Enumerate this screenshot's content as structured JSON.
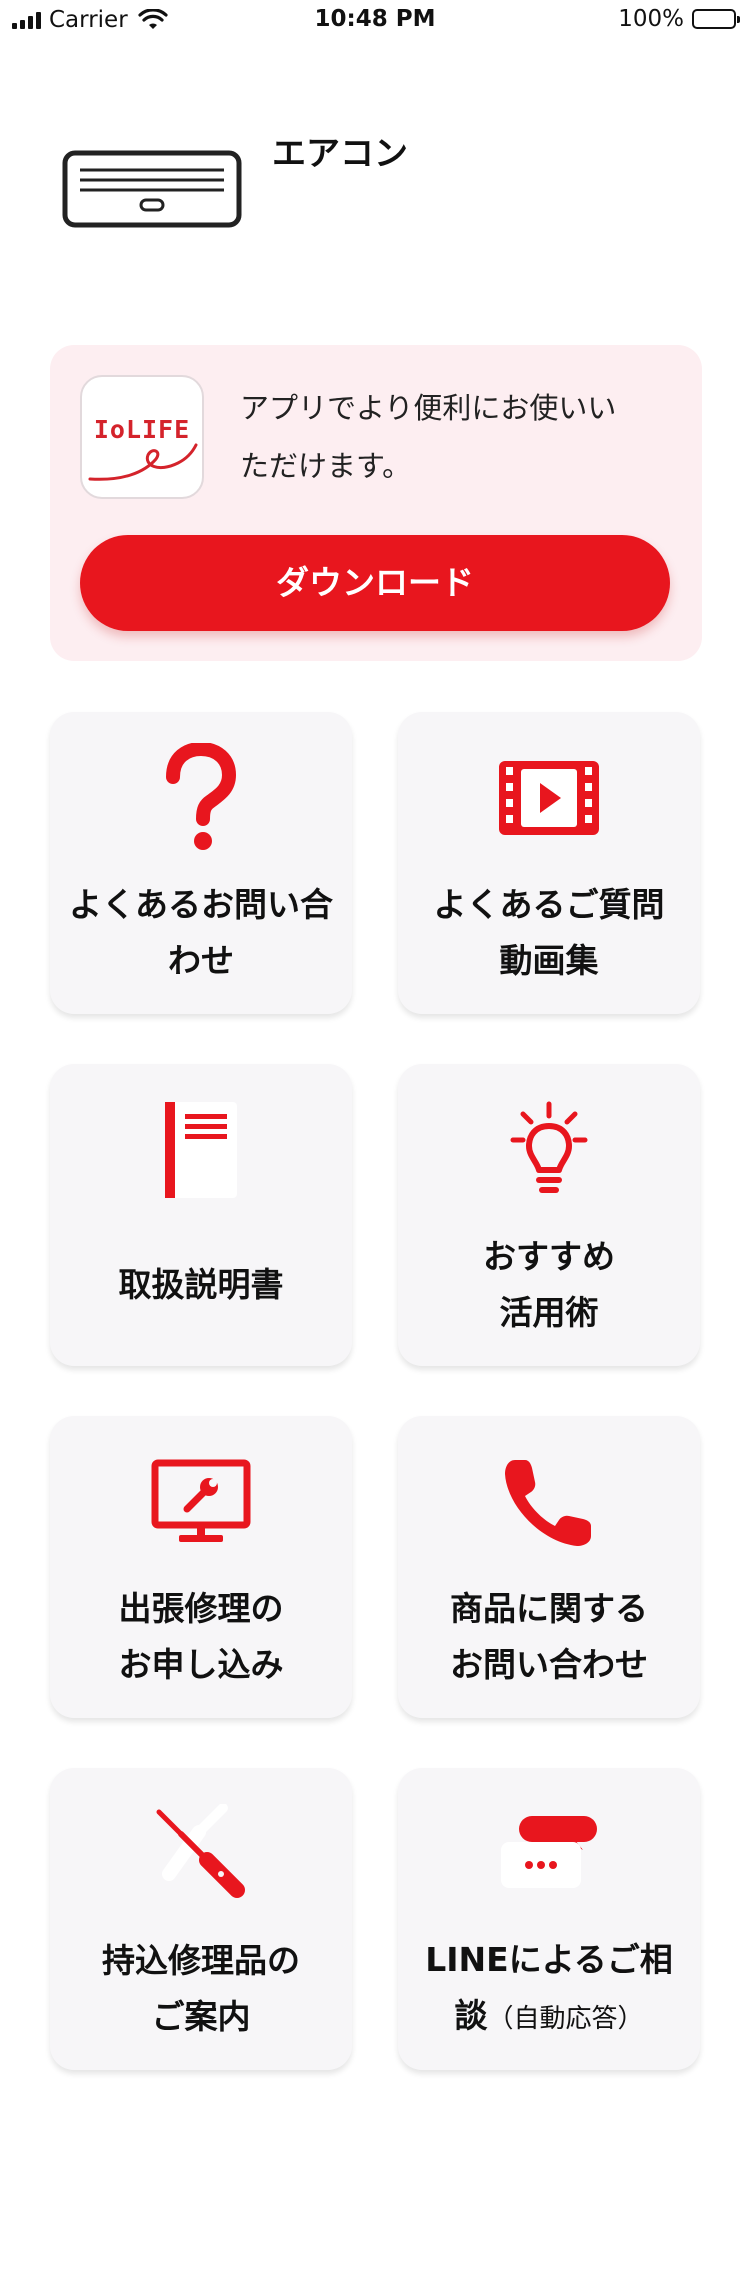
{
  "status_bar": {
    "carrier": "Carrier",
    "time": "10:48 PM",
    "battery": "100%"
  },
  "product": {
    "title": "エアコン",
    "icon": "air-conditioner-icon"
  },
  "promo": {
    "app_icon_text": "IoLIFE",
    "message_line1": "アプリでより便利にお使いい",
    "message_line2": "ただけます。",
    "download_label": "ダウンロード"
  },
  "tiles": [
    {
      "icon": "question-mark-icon",
      "line1": "よくあるお問い合",
      "line2": "わせ"
    },
    {
      "icon": "video-icon",
      "line1": "よくあるご質問",
      "line2": "動画集"
    },
    {
      "icon": "manual-book-icon",
      "line1": "取扱説明書"
    },
    {
      "icon": "light-bulb-icon",
      "line1": "おすすめ",
      "line2": "活用術"
    },
    {
      "icon": "monitor-wrench-icon",
      "line1": "出張修理の",
      "line2": "お申し込み"
    },
    {
      "icon": "phone-icon",
      "line1": "商品に関する",
      "line2": "お問い合わせ"
    },
    {
      "icon": "tools-icon",
      "line1": "持込修理品の",
      "line2": "ご案内"
    },
    {
      "icon": "chat-bubble-icon",
      "line1": "LINEによるご相",
      "line2": "談",
      "line2_small": "（自動応答）"
    }
  ],
  "colors": {
    "accent": "#e8161e",
    "promo_bg": "#fdeef1",
    "tile_bg": "#f7f6f8"
  }
}
